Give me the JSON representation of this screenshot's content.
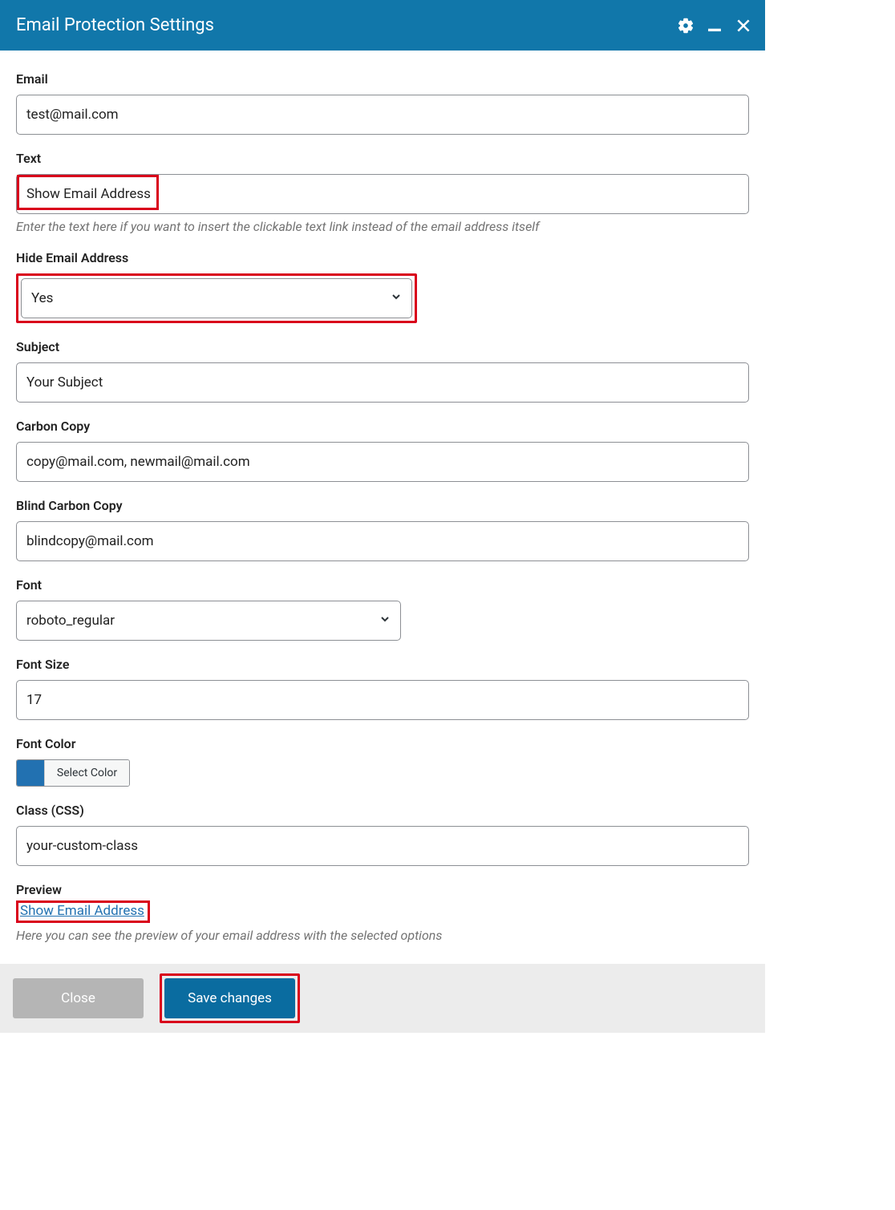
{
  "title": "Email Protection Settings",
  "fields": {
    "email": {
      "label": "Email",
      "value": "test@mail.com"
    },
    "text": {
      "label": "Text",
      "value": "Show Email Address",
      "hint": "Enter the text here if you want to insert the clickable text link instead of the email address itself"
    },
    "hide": {
      "label": "Hide Email Address",
      "value": "Yes"
    },
    "subject": {
      "label": "Subject",
      "value": "Your Subject"
    },
    "cc": {
      "label": "Carbon Copy",
      "value": "copy@mail.com, newmail@mail.com"
    },
    "bcc": {
      "label": "Blind Carbon Copy",
      "value": "blindcopy@mail.com"
    },
    "font": {
      "label": "Font",
      "value": "roboto_regular"
    },
    "font_size": {
      "label": "Font Size",
      "value": "17"
    },
    "font_color": {
      "label": "Font Color",
      "button": "Select Color",
      "swatch": "#2271b1"
    },
    "css_class": {
      "label": "Class (CSS)",
      "value": "your-custom-class"
    },
    "preview": {
      "label": "Preview",
      "link": "Show Email Address",
      "hint": "Here you can see the preview of your email address with the selected options"
    }
  },
  "footer": {
    "close": "Close",
    "save": "Save changes"
  }
}
